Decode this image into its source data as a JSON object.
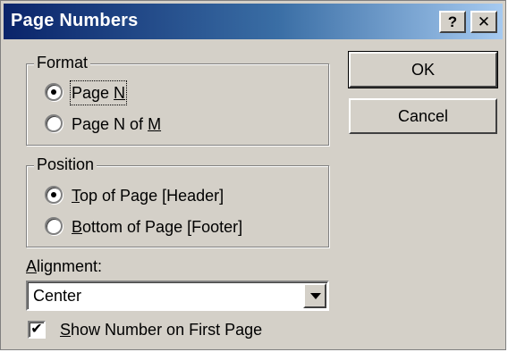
{
  "window": {
    "title": "Page Numbers",
    "help_button": "?",
    "close_button": "✕"
  },
  "format": {
    "legend": "Format",
    "options": [
      {
        "pre": "Page ",
        "key": "N",
        "post": "",
        "selected": true
      },
      {
        "pre": "Page N of ",
        "key": "M",
        "post": "",
        "selected": false
      }
    ]
  },
  "position": {
    "legend": "Position",
    "options": [
      {
        "pre": "",
        "key": "T",
        "post": "op of Page [Header]",
        "selected": true
      },
      {
        "pre": "",
        "key": "B",
        "post": "ottom of Page [Footer]",
        "selected": false
      }
    ]
  },
  "buttons": {
    "ok": "OK",
    "cancel": "Cancel"
  },
  "alignment": {
    "label_key": "A",
    "label_rest": "lignment:",
    "value": "Center"
  },
  "first_page": {
    "checked": true,
    "check_glyph": "✔",
    "label_key": "S",
    "label_rest": "how Number on First Page"
  }
}
